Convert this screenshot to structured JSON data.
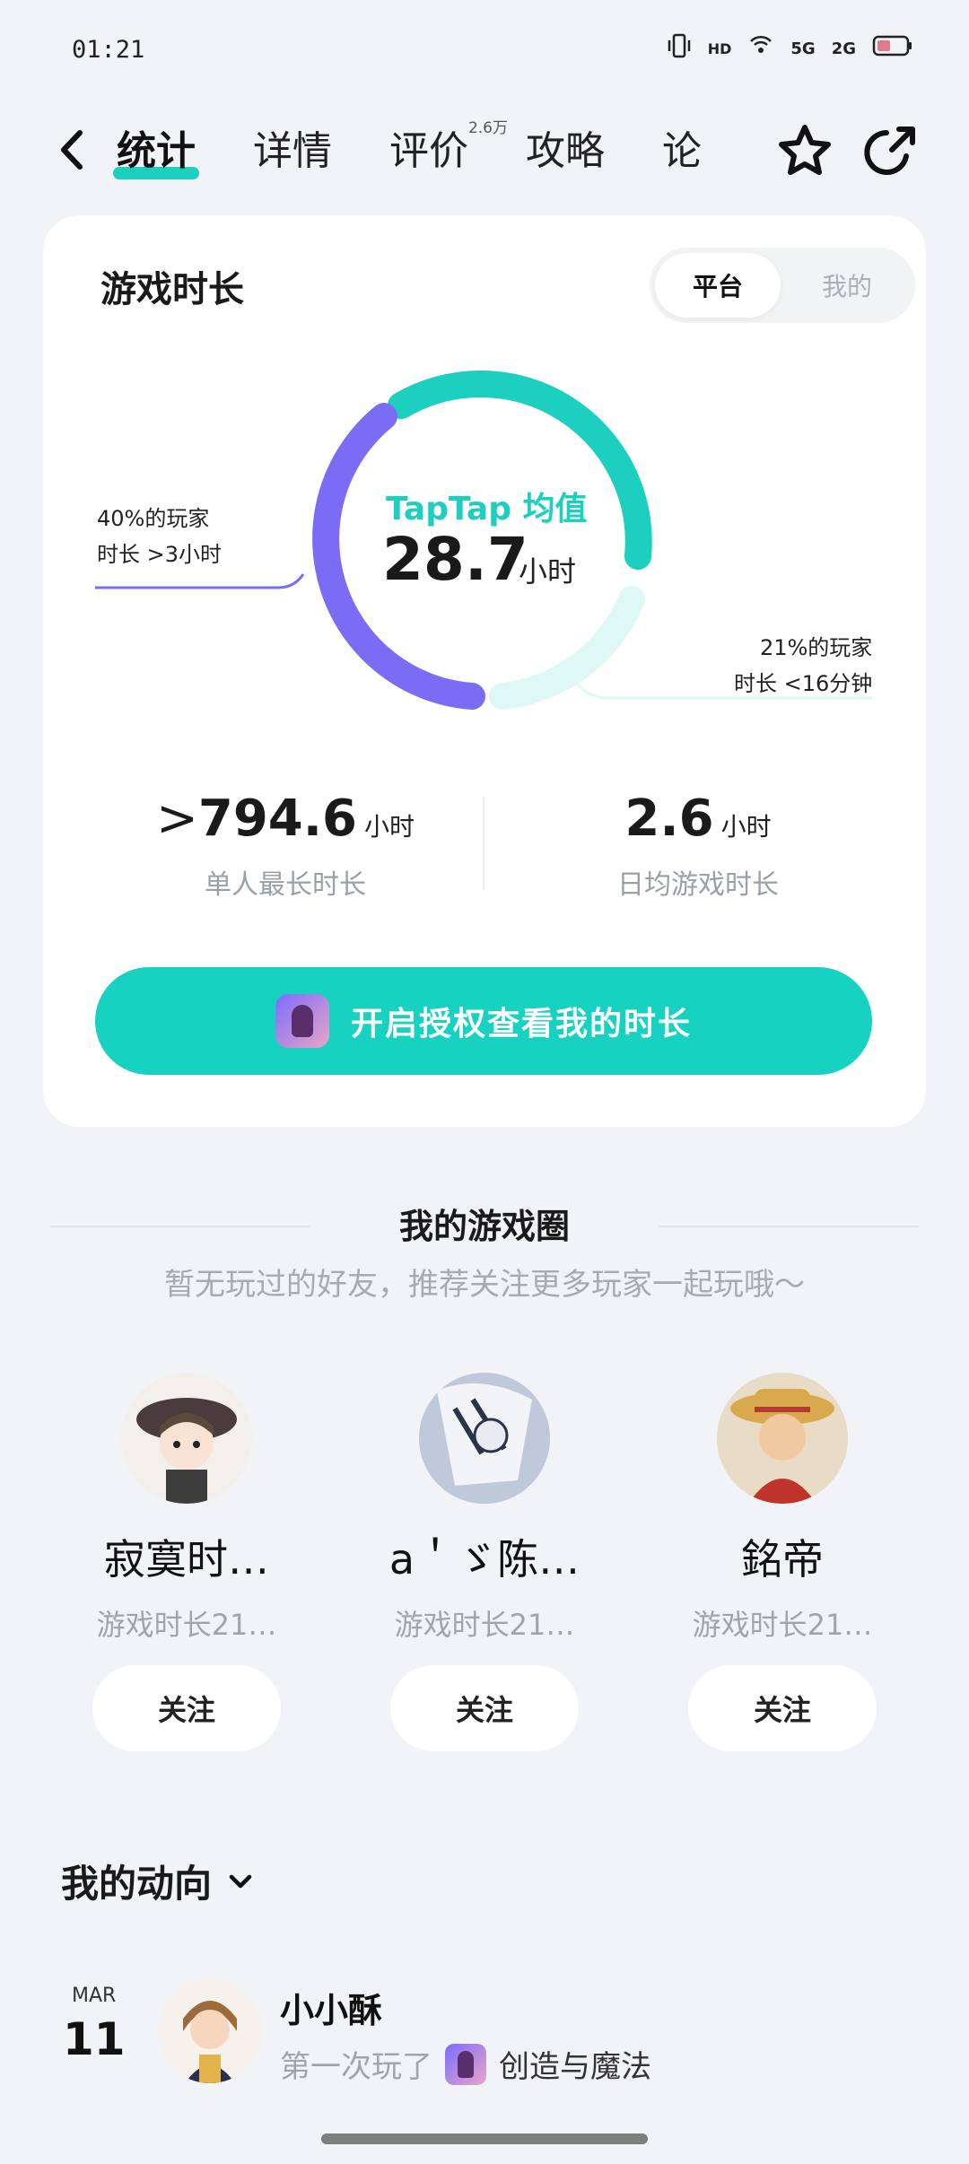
{
  "status_bar": {
    "time": "01:21",
    "icons": [
      "vibrate-icon",
      "hd-icon",
      "hotspot-icon",
      "signal-5g-icon",
      "signal-2g-icon",
      "battery-icon"
    ],
    "network_labels": [
      "HD",
      "5G",
      "2G"
    ]
  },
  "nav": {
    "tabs": [
      {
        "label": "统计",
        "active": true
      },
      {
        "label": "详情",
        "active": false
      },
      {
        "label": "评价",
        "badge": "2.6万",
        "active": false
      },
      {
        "label": "攻略",
        "active": false
      },
      {
        "label": "论",
        "active": false
      }
    ]
  },
  "playtime": {
    "title": "游戏时长",
    "toggle": {
      "platform": "平台",
      "mine": "我的"
    },
    "ring": {
      "brand": "TapTap 均值",
      "value": "28.7",
      "unit": "小时",
      "left_label_line1": "40%的玩家",
      "left_label_line2": "时长 >3小时",
      "right_label_line1": "21%的玩家",
      "right_label_line2": "时长 <16分钟",
      "colors": {
        "teal": "#1CCFBE",
        "purple": "#7B6CF6",
        "light_teal": "#DDF8F5"
      }
    },
    "stats": {
      "max": {
        "prefix": ">",
        "value": "794.6",
        "unit": "小时",
        "label": "单人最长时长"
      },
      "daily": {
        "value": "2.6",
        "unit": "小时",
        "label": "日均游戏时长"
      }
    },
    "auth_button": "开启授权查看我的时长"
  },
  "game_circle": {
    "title": "我的游戏圈",
    "subtitle": "暂无玩过的好友，推荐关注更多玩家一起玩哦～",
    "friends": [
      {
        "name": "寂寞时…",
        "desc": "游戏时长21…",
        "follow": "关注"
      },
      {
        "name": "a＇ゞ陈…",
        "desc": "游戏时长21…",
        "follow": "关注"
      },
      {
        "name": "銘帝",
        "desc": "游戏时长21…",
        "follow": "关注"
      }
    ]
  },
  "activity": {
    "title": "我的动向",
    "items": [
      {
        "month": "MAR",
        "day": "11",
        "user": "小小酥",
        "prefix": "第一次玩了",
        "game": "创造与魔法"
      }
    ]
  }
}
